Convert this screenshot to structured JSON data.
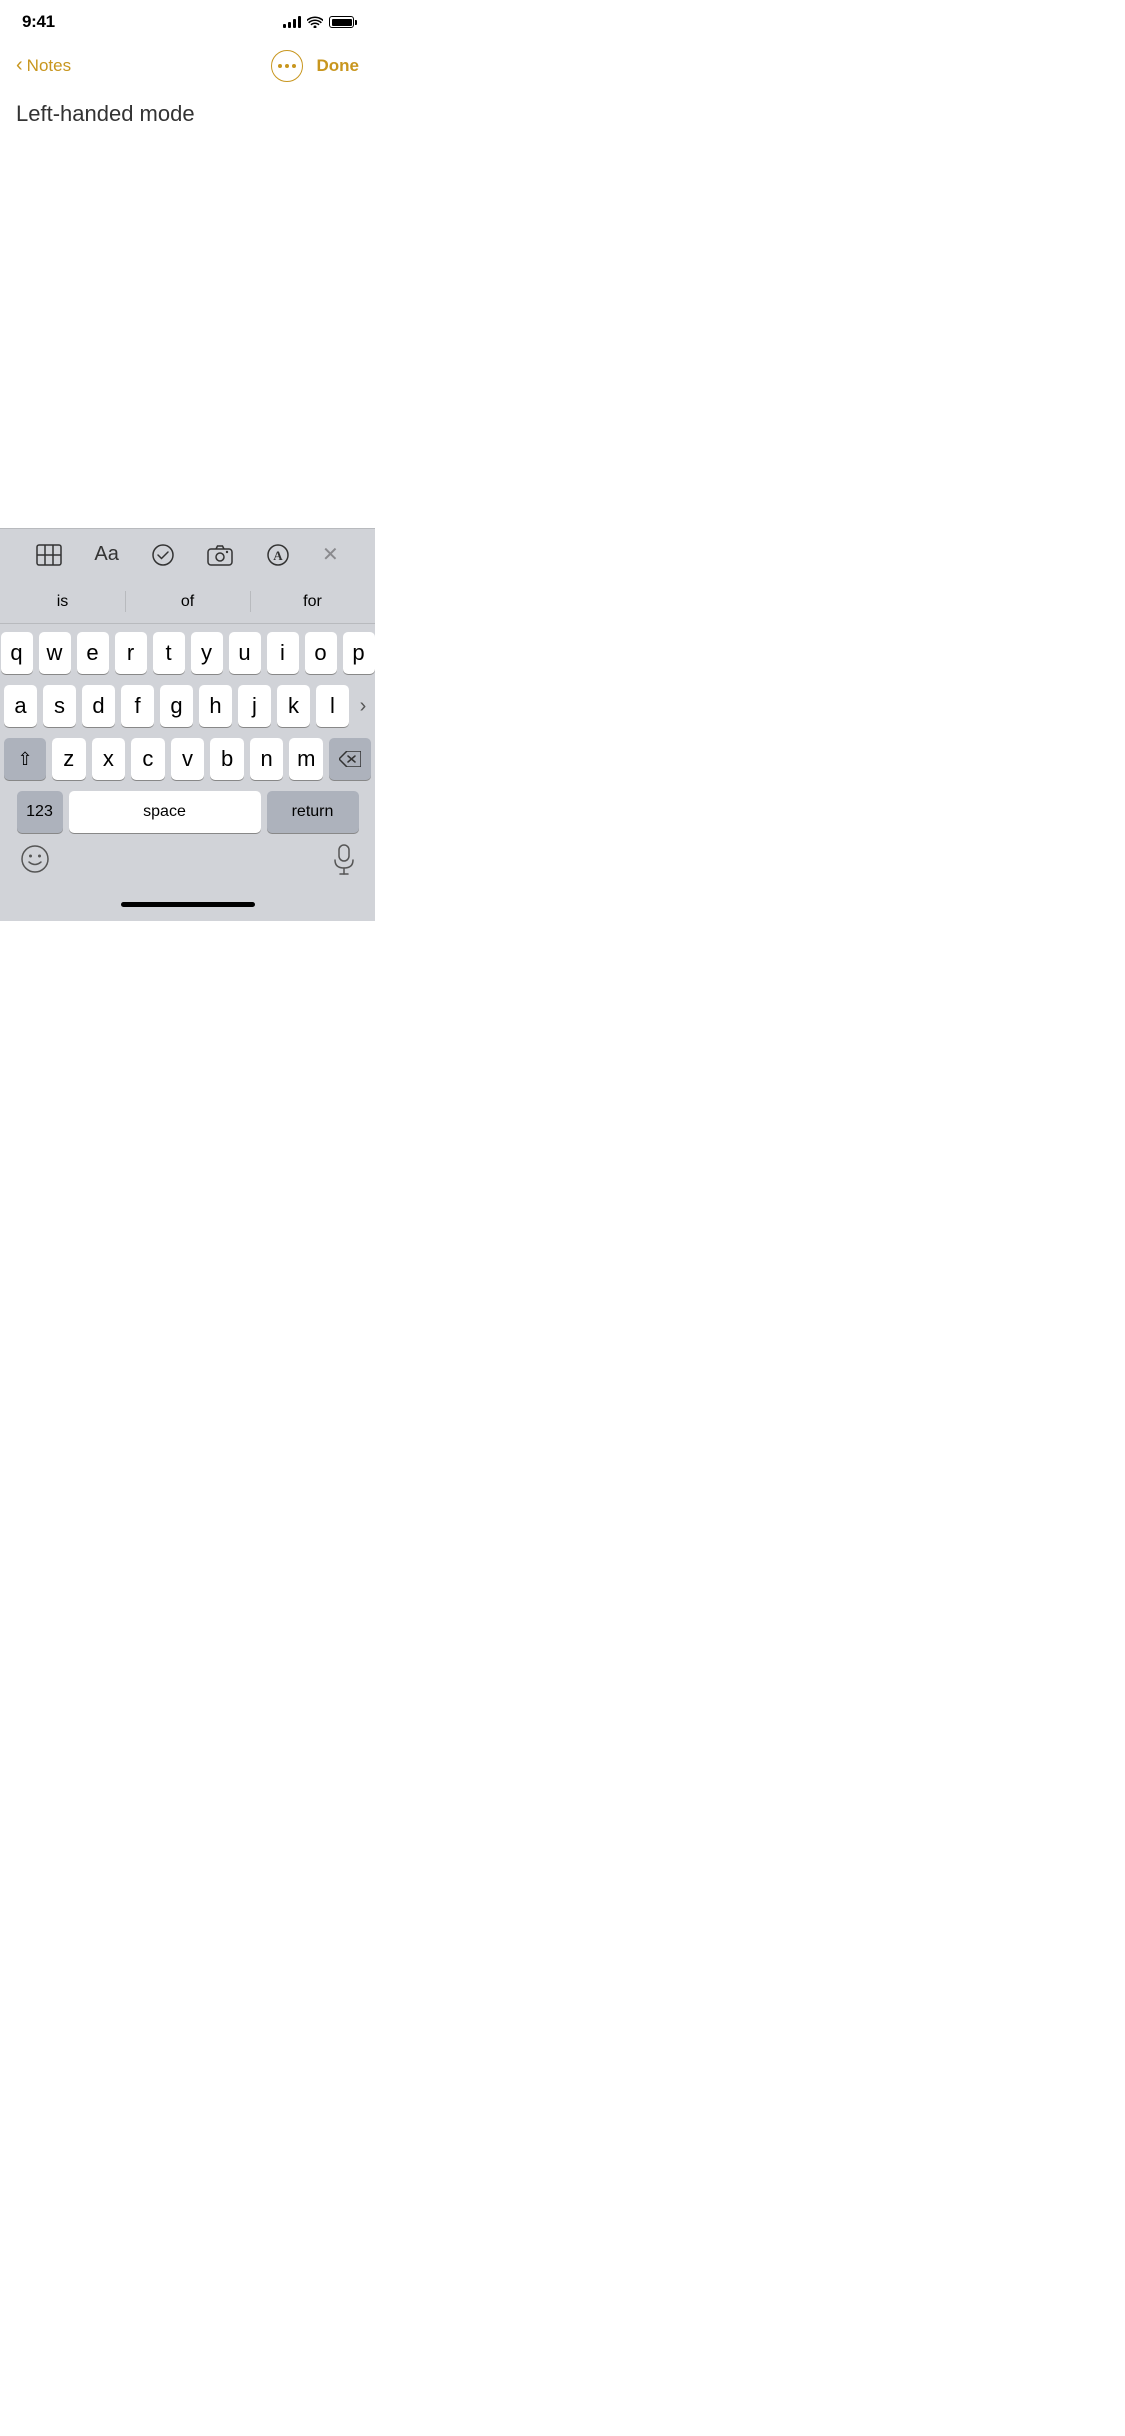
{
  "statusBar": {
    "time": "9:41",
    "signal": 4,
    "wifi": true,
    "battery": 100
  },
  "nav": {
    "backLabel": "Notes",
    "doneLabel": "Done"
  },
  "note": {
    "title": "Left-handed mode"
  },
  "toolbar": {
    "table": "table",
    "format": "Aa",
    "checklist": "checklist",
    "camera": "camera",
    "markup": "markup",
    "close": "✕"
  },
  "predictive": {
    "words": [
      "is",
      "of",
      "for"
    ]
  },
  "keyboard": {
    "rows": [
      [
        "q",
        "w",
        "e",
        "r",
        "t",
        "y",
        "u",
        "i",
        "o",
        "p"
      ],
      [
        "a",
        "s",
        "d",
        "f",
        "g",
        "h",
        "j",
        "k",
        "l"
      ],
      [
        "z",
        "x",
        "c",
        "v",
        "b",
        "n",
        "m"
      ]
    ],
    "special": {
      "numbers": "123",
      "space": "space",
      "return": "return"
    }
  },
  "colors": {
    "accent": "#c8961e",
    "keyBg": "#ffffff",
    "specialKeyBg": "#adb2bc",
    "keyboardBg": "#d1d3d8"
  }
}
